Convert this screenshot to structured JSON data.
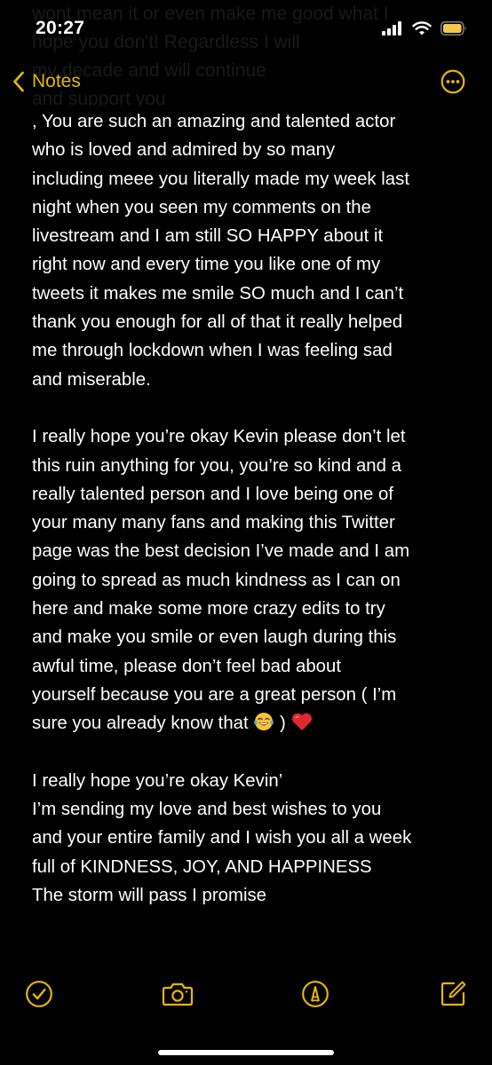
{
  "status_bar": {
    "time": "20:27"
  },
  "ghost_text": "wont mean it or even make me good what I\nhope you don't! Regardless I will\nmy decade and will continue\nand support you",
  "nav": {
    "back_label": "Notes",
    "accent_color": "#e6b800"
  },
  "note": {
    "paragraph_1_lines": [
      ", You are such an amazing and talented actor",
      "who is loved and admired by so many",
      "including meee you literally made my week last",
      "night when you seen my comments on the",
      "livestream and I am still SO HAPPY about it",
      "right now and every time you like one of my",
      "tweets it makes me smile SO much and I can’t",
      "thank you enough for all of that it really helped",
      "me through lockdown when I was feeling sad",
      "and miserable."
    ],
    "paragraph_2_lines": [
      "I really hope you’re okay Kevin please don’t let",
      "this ruin anything for you, you’re so kind and a",
      "really talented person and I love being one of",
      "your many many fans and making this Twitter",
      "page was the best decision I’ve made and I am",
      "going to spread as much kindness as I can on",
      "here and make some more crazy edits to try",
      "and make you smile or even laugh during this",
      "awful time, please don’t feel bad about",
      "yourself because you are a great person ( I’m"
    ],
    "paragraph_2_last_prefix": "sure you already know that ",
    "paragraph_2_last_mid": " ) ",
    "paragraph_3_lines": [
      "I really hope you’re okay Kevin’",
      "I’m sending my love and best wishes to you",
      "and your entire family and I wish you all a week",
      "full of KINDNESS, JOY, AND HAPPINESS",
      "The storm will pass I promise"
    ]
  },
  "toolbar": {
    "icons": [
      "checklist-icon",
      "camera-icon",
      "markup-icon",
      "compose-icon"
    ]
  }
}
